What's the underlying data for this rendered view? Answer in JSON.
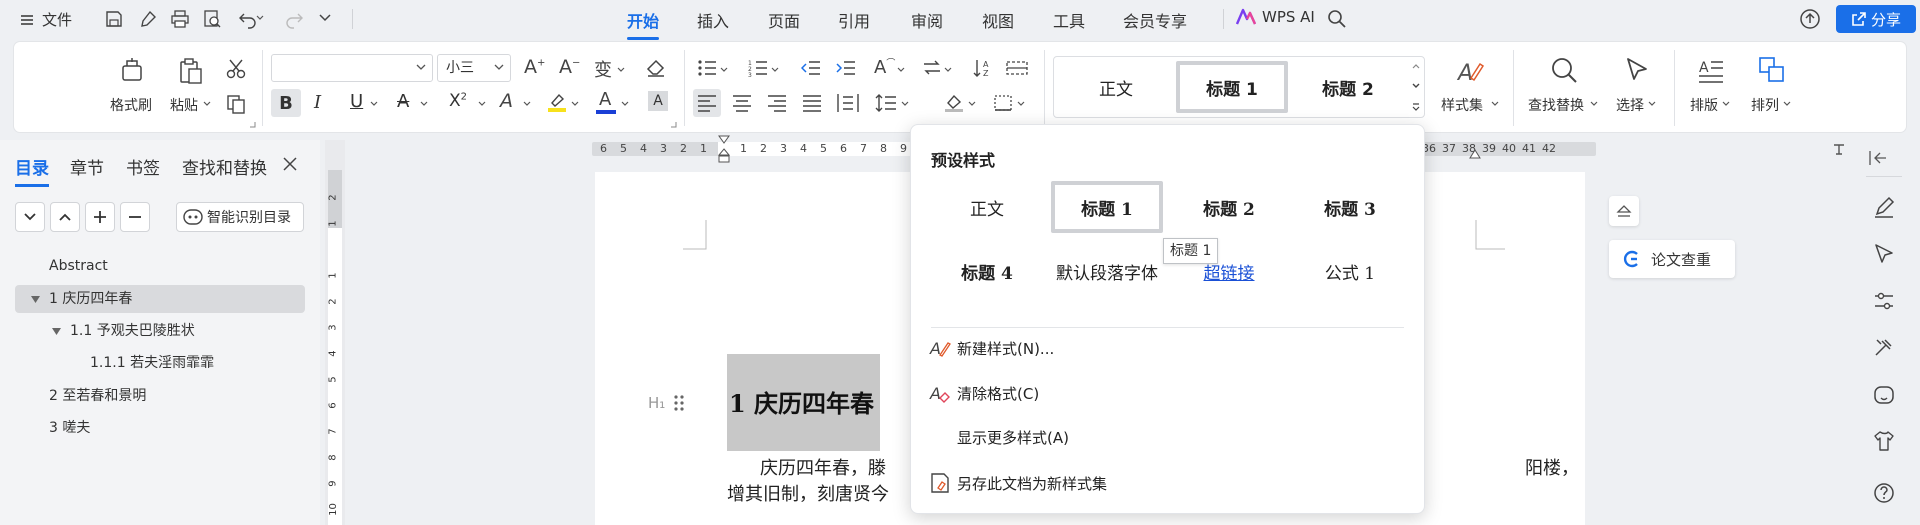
{
  "menubar": {
    "file_label": "文件",
    "tabs": [
      "开始",
      "插入",
      "页面",
      "引用",
      "审阅",
      "视图",
      "工具",
      "会员专享"
    ],
    "active_tab": "开始",
    "wps_ai_label": "WPS AI",
    "share_label": "分享"
  },
  "ribbon": {
    "format_painter": "格式刷",
    "paste": "粘贴",
    "font_size": "小三",
    "style_normal": "正文",
    "style_h1": "标题 1",
    "style_h2": "标题 2",
    "style_set": "样式集",
    "find_replace": "查找替换",
    "select": "选择",
    "layout": "排版",
    "arrange": "排列"
  },
  "left_panel": {
    "tabs": [
      "目录",
      "章节",
      "书签",
      "查找和替换"
    ],
    "active_tab": "目录",
    "smart_toc_label": "智能识别目录",
    "toc": [
      {
        "label": "Abstract",
        "level": 0,
        "expandable": false
      },
      {
        "label": "1 庆历四年春",
        "level": 0,
        "expandable": true
      },
      {
        "label": "1.1 予观夫巴陵胜状",
        "level": 1,
        "expandable": true
      },
      {
        "label": "1.1.1 若夫淫雨霏霏",
        "level": 2,
        "expandable": false
      },
      {
        "label": "2 至若春和景明",
        "level": 0,
        "expandable": false
      },
      {
        "label": "3 嗟夫",
        "level": 0,
        "expandable": false
      }
    ],
    "selected_index": 1
  },
  "ruler": {
    "left_numbers": [
      "6",
      "5",
      "4",
      "3",
      "2",
      "1"
    ],
    "mid_numbers": [
      "1",
      "2",
      "3",
      "4",
      "5",
      "6",
      "7",
      "8",
      "9"
    ],
    "right_numbers": [
      "36",
      "37",
      "38",
      "39",
      "40",
      "41",
      "42"
    ],
    "vertical_numbers": [
      "2",
      "1",
      "1",
      "2",
      "3",
      "4",
      "5",
      "6",
      "7",
      "8",
      "9",
      "10"
    ]
  },
  "document": {
    "heading_text": "1 庆历四年春",
    "heading_marker": "H₁",
    "line1_left": "庆历四年春，滕",
    "line1_right": "阳楼，",
    "line2_left": "增其旧制，刻唐贤今"
  },
  "right_panel": {
    "paper_check_label": "论文查重"
  },
  "popup": {
    "title": "预设样式",
    "styles": [
      {
        "label": "正文",
        "kind": "normal"
      },
      {
        "label": "标题 1",
        "kind": "bold",
        "selected": true
      },
      {
        "label": "标题 2",
        "kind": "bold"
      },
      {
        "label": "标题 3",
        "kind": "bold"
      },
      {
        "label": "标题 4",
        "kind": "bold"
      },
      {
        "label": "默认段落字体",
        "kind": "normal"
      },
      {
        "label": "超链接",
        "kind": "link"
      },
      {
        "label": "公式 1",
        "kind": "normal"
      }
    ],
    "tooltip": "标题 1",
    "menu": {
      "new_style": "新建样式(N)...",
      "clear_format": "清除格式(C)",
      "more_styles": "显示更多样式(A)",
      "save_styleset": "另存此文档为新样式集"
    }
  },
  "colors": {
    "accent": "#1a6fe8",
    "highlight_yellow": "#f7e11c",
    "font_color_blue": "#1a3fd6",
    "selection_gray": "#c8c8c8"
  }
}
